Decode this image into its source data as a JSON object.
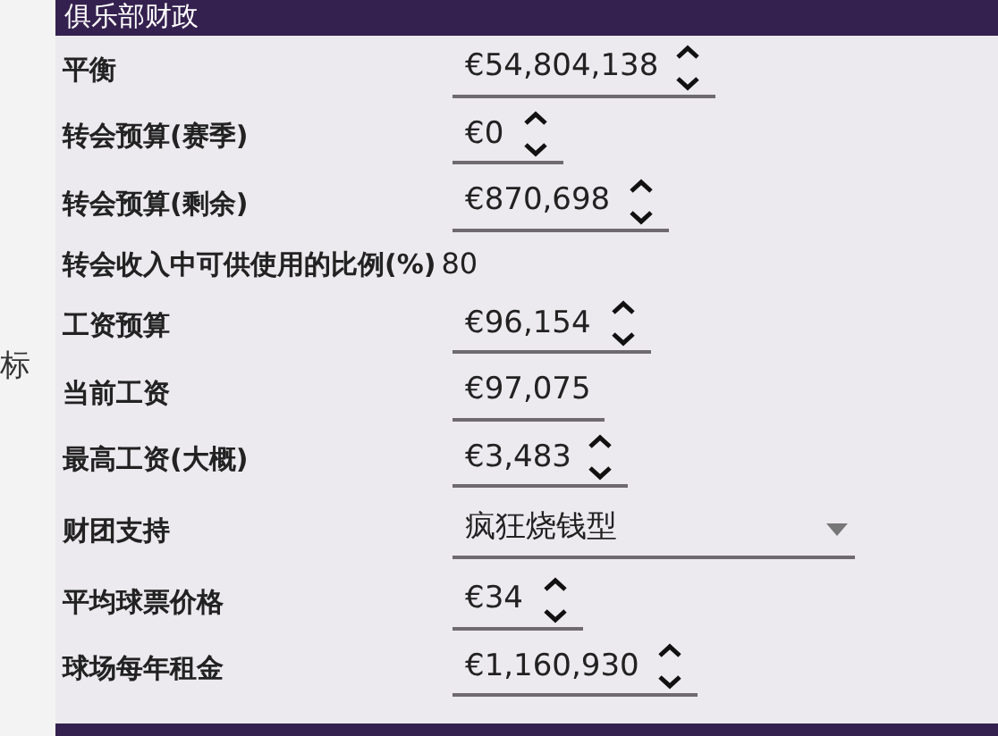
{
  "side_label": "标",
  "panel": {
    "title": "俱乐部财政",
    "rows": [
      {
        "label": "平衡",
        "kind": "spinner",
        "value": "€54,804,138"
      },
      {
        "label": "转会预算(赛季)",
        "kind": "spinner",
        "value": "€0"
      },
      {
        "label": "转会预算(剩余)",
        "kind": "spinner",
        "value": "€870,698"
      },
      {
        "label": "转会收入中可供使用的比例(%)",
        "kind": "text",
        "value": "80"
      },
      {
        "label": "工资预算",
        "kind": "spinner",
        "value": "€96,154"
      },
      {
        "label": "当前工资",
        "kind": "readonly",
        "value": "€97,075"
      },
      {
        "label": "最高工资(大概)",
        "kind": "spinner",
        "value": "€3,483"
      },
      {
        "label": "财团支持",
        "kind": "dropdown",
        "value": "疯狂烧钱型"
      },
      {
        "label": "平均球票价格",
        "kind": "spinner",
        "value": "€34"
      },
      {
        "label": "球场每年租金",
        "kind": "spinner",
        "value": "€1,160,930"
      }
    ]
  }
}
